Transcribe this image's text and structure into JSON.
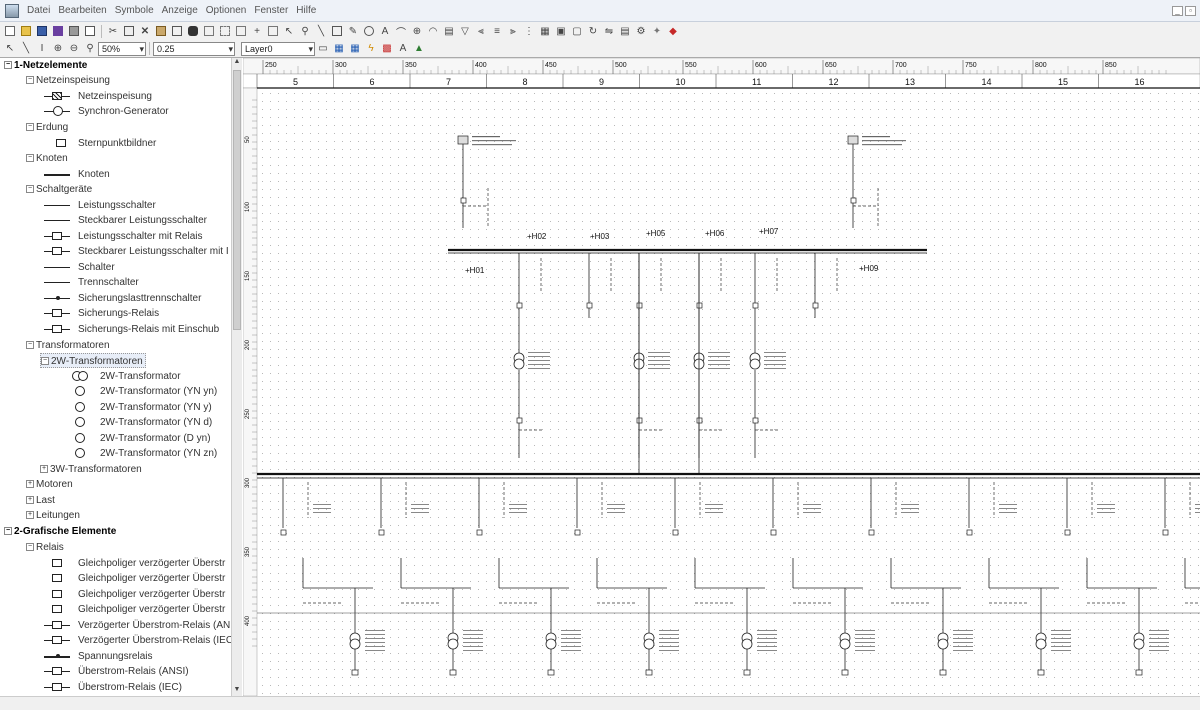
{
  "menu": [
    "Datei",
    "Bearbeiten",
    "Symbole",
    "Anzeige",
    "Optionen",
    "Fenster",
    "Hilfe"
  ],
  "toolbar": {
    "zoom": "50%",
    "color_label": "0.25",
    "layer": "Layer0"
  },
  "tree": {
    "netz": "1-Netzelemente",
    "netzeinspeisung": "Netzeinspeisung",
    "item_netzeinspeisung": "Netzeinspeisung",
    "item_synchron": "Synchron-Generator",
    "erdung": "Erdung",
    "item_stern": "Sternpunktbildner",
    "knoten": "Knoten",
    "item_knoten": "Knoten",
    "schaltgeraete": "Schaltgeräte",
    "sg": [
      "Leistungsschalter",
      "Steckbarer Leistungsschalter",
      "Leistungsschalter mit Relais",
      "Steckbarer Leistungsschalter mit I",
      "Schalter",
      "Trennschalter",
      "Sicherungslasttrennschalter",
      "Sicherungs-Relais",
      "Sicherungs-Relais mit Einschub"
    ],
    "transformatoren": "Transformatoren",
    "tr2w": "2W-Transformatoren",
    "t2": [
      "2W-Transformator",
      "2W-Transformator (YN yn)",
      "2W-Transformator (YN y)",
      "2W-Transformator (YN d)",
      "2W-Transformator (D yn)",
      "2W-Transformator (YN zn)"
    ],
    "tr3w": "3W-Transformatoren",
    "motoren": "Motoren",
    "last": "Last",
    "leitungen": "Leitungen",
    "grafisch": "2-Grafische Elemente",
    "relais": "Relais",
    "rel": [
      "Gleichpoliger verzögerter Überstr",
      "Gleichpoliger verzögerter Überstr",
      "Gleichpoliger verzögerter Überstr",
      "Gleichpoliger verzögerter Überstr",
      "Verzögerter Überstrom-Relais (AN",
      "Verzögerter Überstrom-Relais (IEC",
      "Spannungsrelais",
      "Überstrom-Relais (ANSI)",
      "Überstrom-Relais (IEC)"
    ]
  },
  "ruler": {
    "top": [
      "250",
      "300",
      "350",
      "400",
      "450",
      "500",
      "550",
      "600",
      "650",
      "700",
      "750",
      "800",
      "850"
    ],
    "cols": [
      "5",
      "6",
      "7",
      "8",
      "9",
      "10",
      "11",
      "12",
      "13",
      "14",
      "15",
      "16"
    ],
    "left": [
      "50",
      "100",
      "150",
      "200",
      "250",
      "300",
      "350",
      "400"
    ]
  },
  "diagram": {
    "bus_labels": [
      "+H02",
      "+H03",
      "+H05",
      "+H06",
      "+H07"
    ],
    "h01": "+H01",
    "h09": "+H09"
  }
}
